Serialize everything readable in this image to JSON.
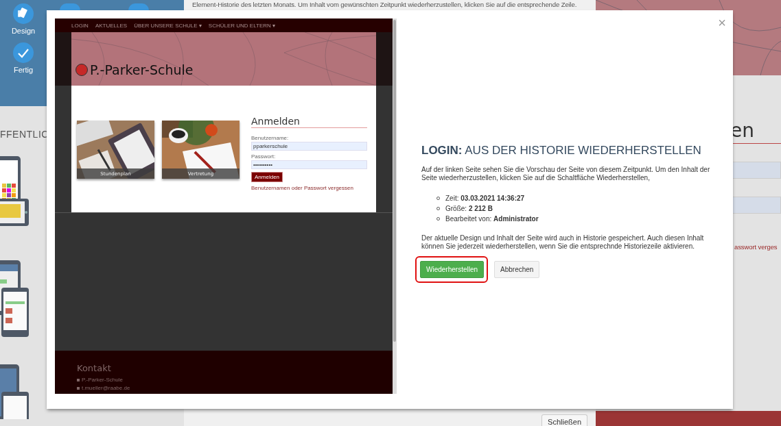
{
  "sidebar": {
    "items": [
      {
        "label": "Design"
      },
      {
        "label": "Fertig"
      }
    ]
  },
  "left_panel": {
    "heading": "FFENTLIC"
  },
  "history_panel": {
    "intro": "Element-Historie des letzten Monats. Um Inhalt vom gewünschten Zeitpunkt wiederherzustellen, klicken Sie auf die entsprechende Zeile.",
    "close_button": "Schließen"
  },
  "background_page": {
    "heading": "en",
    "link": "asswort verges"
  },
  "dialog": {
    "close": "×",
    "preview": {
      "nav": [
        "LOGIN",
        "AKTUELLES",
        "ÜBER UNSERE SCHULE ▾",
        "SCHÜLER UND ELTERN ▾"
      ],
      "site_title": "P.-Parker-Schule",
      "tiles": [
        {
          "caption": "Stundenplan",
          "kind": "picture"
        },
        {
          "caption": "Vertretung",
          "kind": "picture"
        }
      ],
      "login": {
        "heading": "Anmelden",
        "username_label": "Benutzername:",
        "username_value": "pparkerschule",
        "password_label": "Passwort:",
        "password_value": "••••••••••",
        "button": "Anmelden",
        "forgot_link": "Benutzernamen oder Passwort vergessen"
      },
      "footer": {
        "heading": "Kontakt",
        "lines": [
          "P.-Parker-Schule",
          "t.mueller@raabe.de"
        ]
      }
    },
    "title": "**LOGIN:** AUS DER HISTORIE WIEDERHERSTELLEN",
    "description": "Auf der linken Seite sehen Sie die Vorschau der Seite von diesem Zeitpunkt. Um den Inhalt der Seite wiederherzustellen, klicken Sie auf die Schaltfläche Wiederherstellen,",
    "details": [
      "Zeit: **03.03.2021 14:36:27**",
      "Größe: **2 212 B**",
      "Bearbeitet von: **Administrator**"
    ],
    "note": "Der aktuelle Design und Inhalt der Seite wird auch in Historie gespeichert. Auch diesen Inhalt können Sie jederzeit wiederherstellen, wenn Sie die entsprechnde Historiezeile aktivieren.",
    "buttons": [
      {
        "label": "Wiederherstellen",
        "kind": "primary",
        "highlighted": true
      },
      {
        "label": "Abbrechen",
        "kind": "secondary",
        "highlighted": false
      }
    ]
  }
}
